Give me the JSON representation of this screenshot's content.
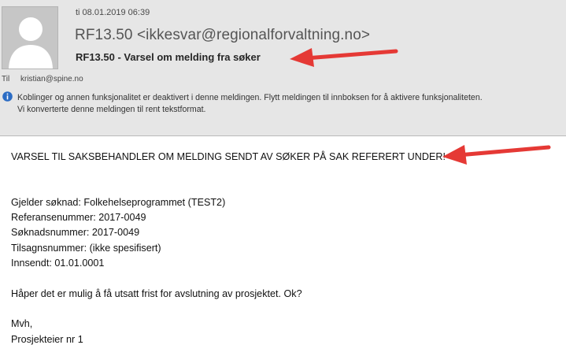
{
  "message": {
    "date": "ti 08.01.2019 06:39",
    "sender": "RF13.50 <ikkesvar@regionalforvaltning.no>",
    "subject": "RF13.50 - Varsel om melding fra søker",
    "to_label": "Til",
    "to_value": "kristian@spine.no",
    "info_line1": "Koblinger og annen funksjonalitet er deaktivert i denne meldingen. Flytt meldingen til innboksen for å aktivere funksjonaliteten.",
    "info_line2": "Vi konverterte denne meldingen til rent tekstformat."
  },
  "body": {
    "heading": "VARSEL TIL SAKSBEHANDLER OM MELDING SENDT AV SØKER PÅ SAK REFERERT UNDER!",
    "blank1": " ",
    "blank2": " ",
    "line_gjelder": "Gjelder søknad: Folkehelseprogrammet (TEST2)",
    "line_referanse": "Referansenummer: 2017-0049",
    "line_soknad": "Søknadsnummer: 2017-0049",
    "line_tilsagn": "Tilsagnsnummer: (ikke spesifisert)",
    "line_innsendt": "Innsendt: 01.01.0001",
    "blank3": " ",
    "line_message": "Håper det er mulig å få utsatt frist for avslutning av prosjektet. Ok?",
    "blank4": " ",
    "line_greeting": "Mvh,",
    "line_signature": "Prosjekteier nr 1"
  },
  "colors": {
    "header_bg": "#e6e6e6",
    "arrow": "#e53935",
    "info_icon": "#2b6cc4"
  },
  "icons": [
    "person-avatar-icon",
    "info-icon",
    "annotation-arrow"
  ]
}
